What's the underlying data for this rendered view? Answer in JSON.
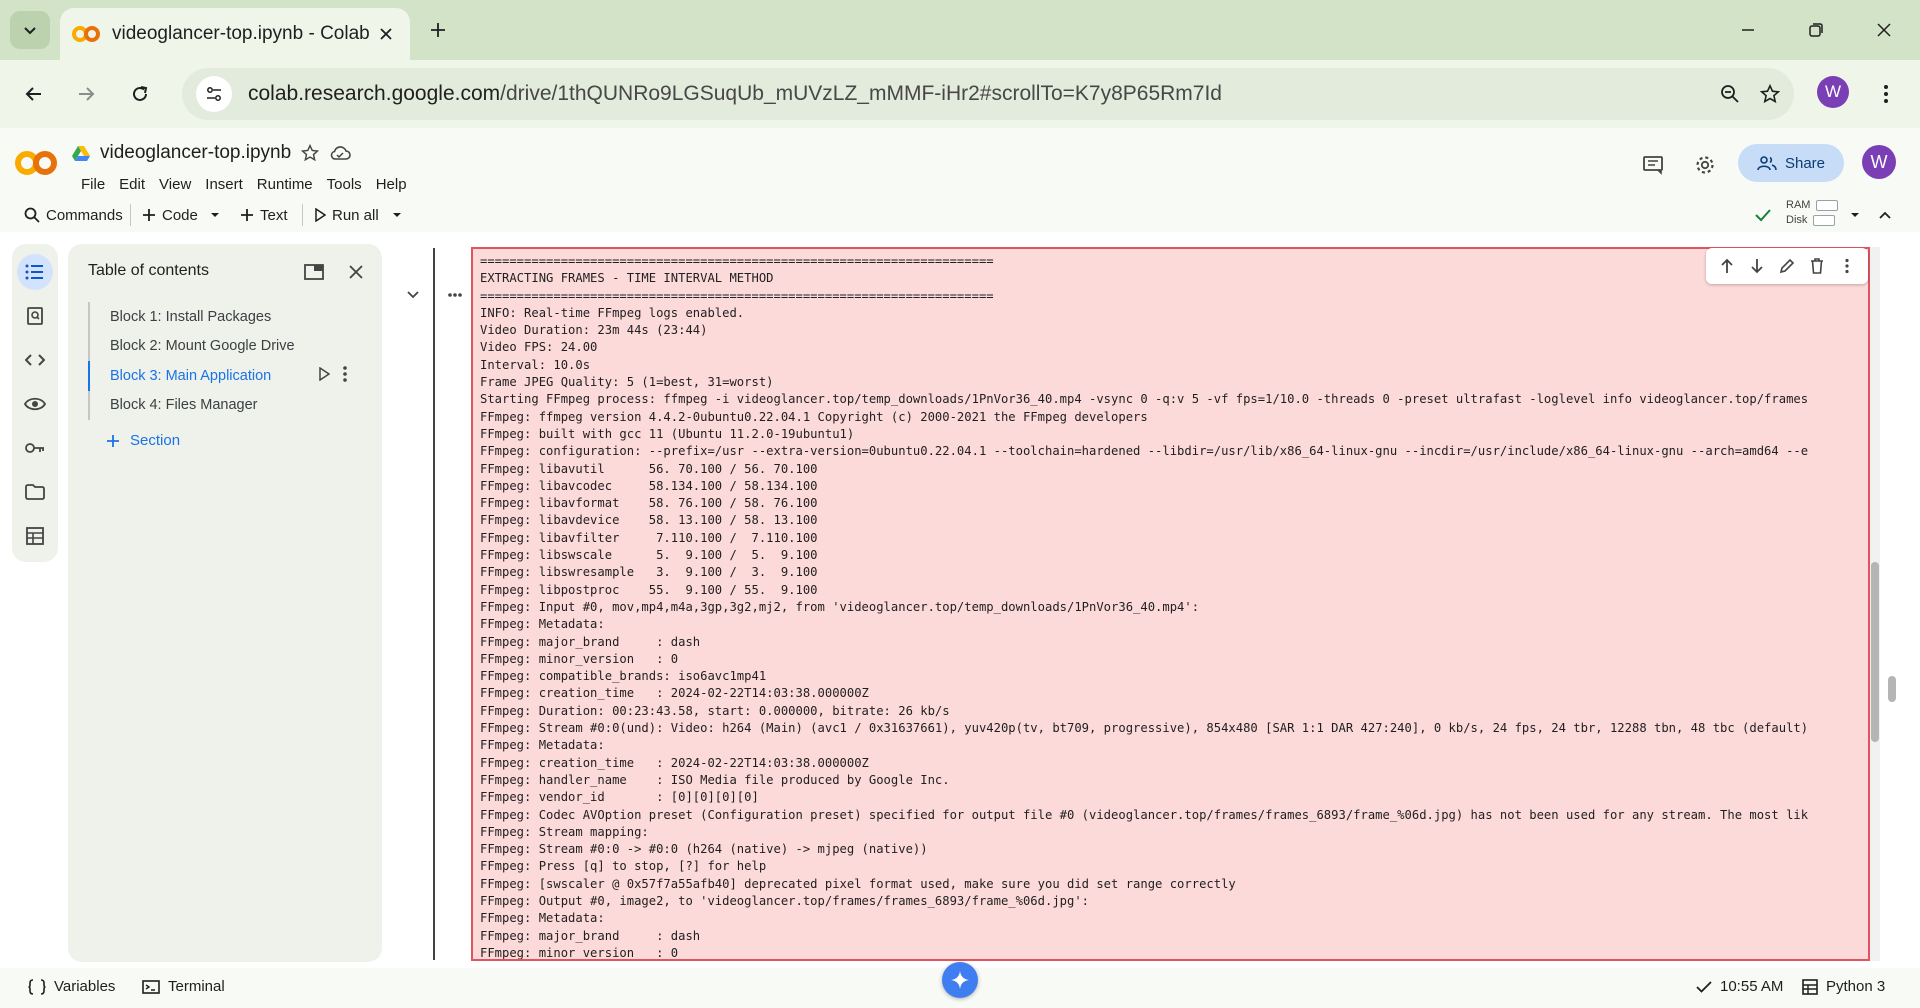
{
  "browser": {
    "tab_title": "videoglancer-top.ipynb - Colab",
    "url_host": "colab.research.google.com",
    "url_path": "/drive/1thQUNRo9LGSuqUb_mUVzLZ_mMMF-iHr2#scrollTo=K7y8P65Rm7Id",
    "profile_initial": "W"
  },
  "header": {
    "notebook_title": "videoglancer-top.ipynb",
    "menu": [
      "File",
      "Edit",
      "View",
      "Insert",
      "Runtime",
      "Tools",
      "Help"
    ],
    "share_label": "Share",
    "avatar_initial": "W"
  },
  "toolbar": {
    "commands": "Commands",
    "code": "Code",
    "text": "Text",
    "run_all": "Run all",
    "ram": "RAM",
    "disk": "Disk"
  },
  "toc": {
    "title": "Table of contents",
    "items": [
      {
        "label": "Block 1: Install Packages"
      },
      {
        "label": "Block 2: Mount Google Drive"
      },
      {
        "label": "Block 3: Main Application"
      },
      {
        "label": "Block 4: Files Manager"
      }
    ],
    "section_label": "Section"
  },
  "output": {
    "lines": [
      "======================================================================",
      "EXTRACTING FRAMES - TIME INTERVAL METHOD",
      "======================================================================",
      "INFO: Real-time FFmpeg logs enabled.",
      "Video Duration: 23m 44s (23:44)",
      "Video FPS: 24.00",
      "Interval: 10.0s",
      "Frame JPEG Quality: 5 (1=best, 31=worst)",
      "Starting FFmpeg process: ffmpeg -i videoglancer.top/temp_downloads/1PnVor36_40.mp4 -vsync 0 -q:v 5 -vf fps=1/10.0 -threads 0 -preset ultrafast -loglevel info videoglancer.top/frames",
      "FFmpeg: ffmpeg version 4.4.2-0ubuntu0.22.04.1 Copyright (c) 2000-2021 the FFmpeg developers",
      "FFmpeg: built with gcc 11 (Ubuntu 11.2.0-19ubuntu1)",
      "FFmpeg: configuration: --prefix=/usr --extra-version=0ubuntu0.22.04.1 --toolchain=hardened --libdir=/usr/lib/x86_64-linux-gnu --incdir=/usr/include/x86_64-linux-gnu --arch=amd64 --e",
      "FFmpeg: libavutil      56. 70.100 / 56. 70.100",
      "FFmpeg: libavcodec     58.134.100 / 58.134.100",
      "FFmpeg: libavformat    58. 76.100 / 58. 76.100",
      "FFmpeg: libavdevice    58. 13.100 / 58. 13.100",
      "FFmpeg: libavfilter     7.110.100 /  7.110.100",
      "FFmpeg: libswscale      5.  9.100 /  5.  9.100",
      "FFmpeg: libswresample   3.  9.100 /  3.  9.100",
      "FFmpeg: libpostproc    55.  9.100 / 55.  9.100",
      "FFmpeg: Input #0, mov,mp4,m4a,3gp,3g2,mj2, from 'videoglancer.top/temp_downloads/1PnVor36_40.mp4':",
      "FFmpeg: Metadata:",
      "FFmpeg: major_brand     : dash",
      "FFmpeg: minor_version   : 0",
      "FFmpeg: compatible_brands: iso6avc1mp41",
      "FFmpeg: creation_time   : 2024-02-22T14:03:38.000000Z",
      "FFmpeg: Duration: 00:23:43.58, start: 0.000000, bitrate: 26 kb/s",
      "FFmpeg: Stream #0:0(und): Video: h264 (Main) (avc1 / 0x31637661), yuv420p(tv, bt709, progressive), 854x480 [SAR 1:1 DAR 427:240], 0 kb/s, 24 fps, 24 tbr, 12288 tbn, 48 tbc (default)",
      "FFmpeg: Metadata:",
      "FFmpeg: creation_time   : 2024-02-22T14:03:38.000000Z",
      "FFmpeg: handler_name    : ISO Media file produced by Google Inc.",
      "FFmpeg: vendor_id       : [0][0][0][0]",
      "FFmpeg: Codec AVOption preset (Configuration preset) specified for output file #0 (videoglancer.top/frames/frames_6893/frame_%06d.jpg) has not been used for any stream. The most lik",
      "FFmpeg: Stream mapping:",
      "FFmpeg: Stream #0:0 -> #0:0 (h264 (native) -> mjpeg (native))",
      "FFmpeg: Press [q] to stop, [?] for help",
      "FFmpeg: [swscaler @ 0x57f7a55afb40] deprecated pixel format used, make sure you did set range correctly",
      "FFmpeg: Output #0, image2, to 'videoglancer.top/frames/frames_6893/frame_%06d.jpg':",
      "FFmpeg: Metadata:",
      "FFmpeg: major_brand     : dash",
      "FFmpeg: minor_version   : 0"
    ]
  },
  "statusbar": {
    "variables": "Variables",
    "terminal": "Terminal",
    "time": "10:55 AM",
    "kernel": "Python 3"
  },
  "colors": {
    "error_bg": "#fddada",
    "error_border": "#e0555f",
    "accent": "#1a73e8",
    "chrome_tab_bg": "#d3e3c8"
  }
}
